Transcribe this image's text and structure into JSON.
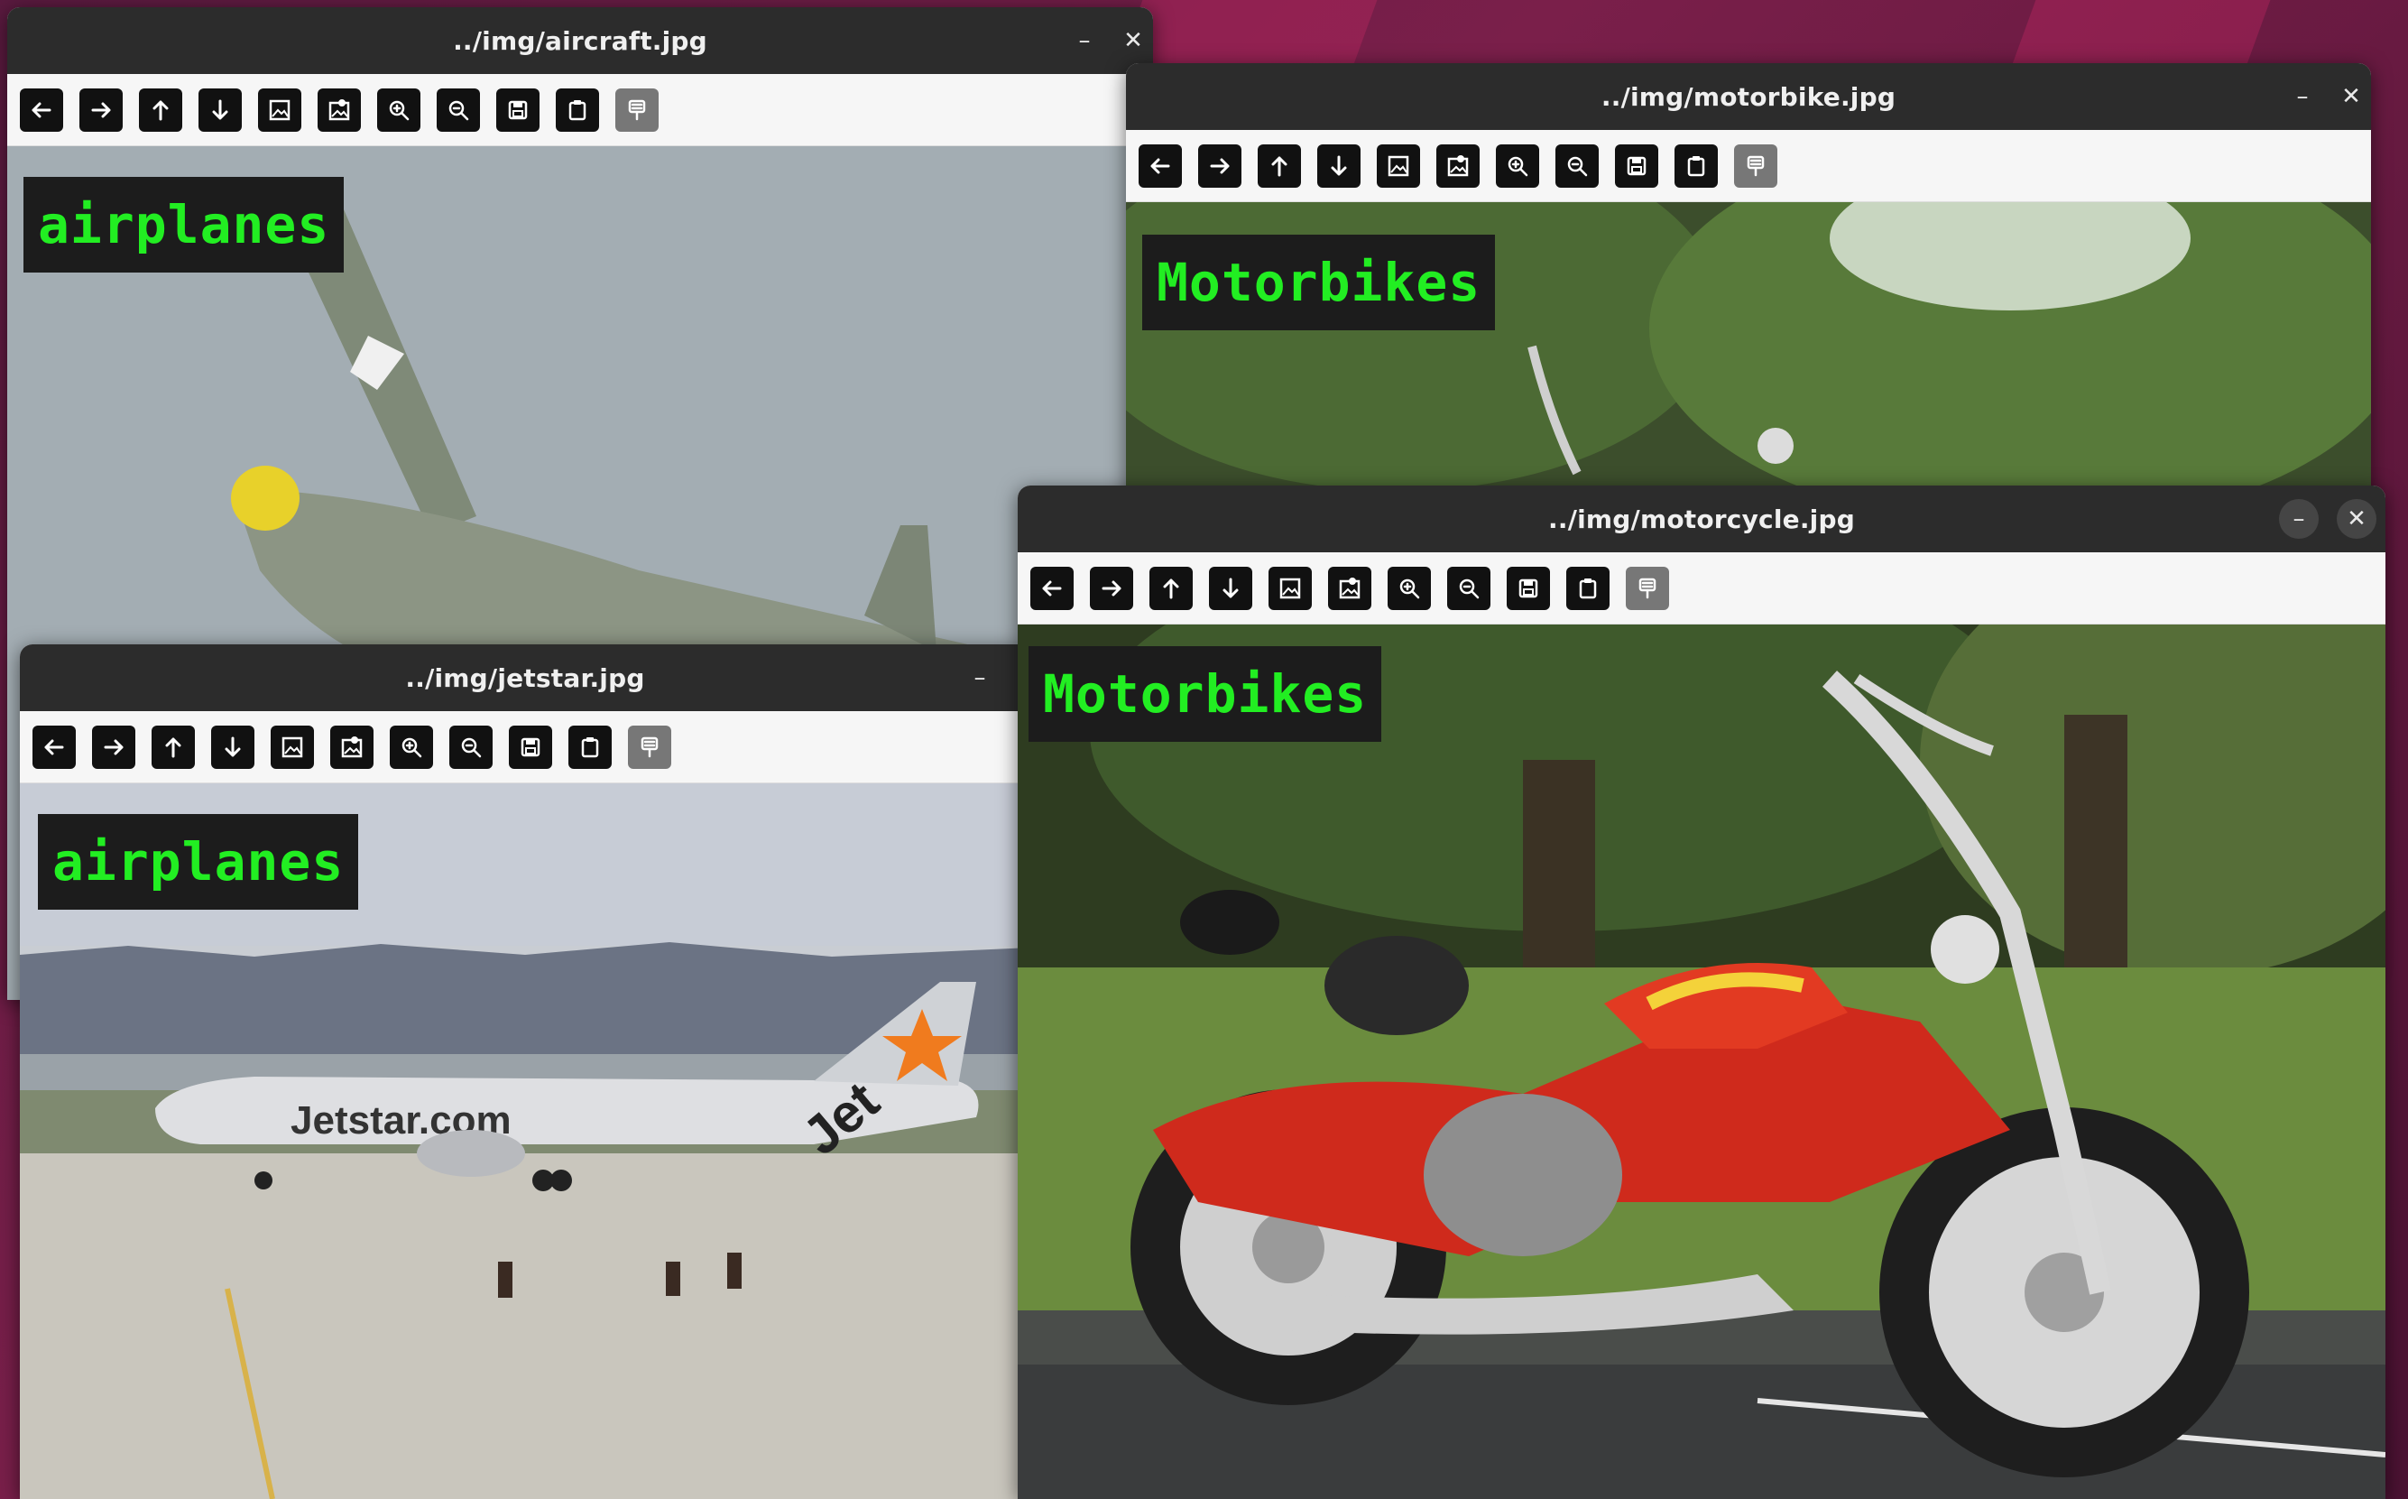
{
  "windows": {
    "aircraft": {
      "title": "../img/aircraft.jpg",
      "label": "airplanes"
    },
    "motorbike": {
      "title": "../img/motorbike.jpg",
      "label": "Motorbikes"
    },
    "jetstar": {
      "title": "../img/jetstar.jpg",
      "label": "airplanes",
      "livery": "Jetstar.com",
      "tail": "Jet"
    },
    "motorcycle": {
      "title": "../img/motorcycle.jpg",
      "label": "Motorbikes"
    }
  },
  "window_controls": {
    "minimize": "–",
    "close": "✕"
  },
  "toolbar_icons": [
    "arrow-left-icon",
    "arrow-right-icon",
    "arrow-up-icon",
    "arrow-down-icon",
    "image-icon",
    "image-person-icon",
    "zoom-in-icon",
    "zoom-out-icon",
    "save-icon",
    "clipboard-icon",
    "properties-icon"
  ],
  "colors": {
    "label_text": "#22ee22",
    "label_bg": "#1c1c1c",
    "titlebar": "#2c2c2c",
    "desktop": "#6a1a44"
  }
}
